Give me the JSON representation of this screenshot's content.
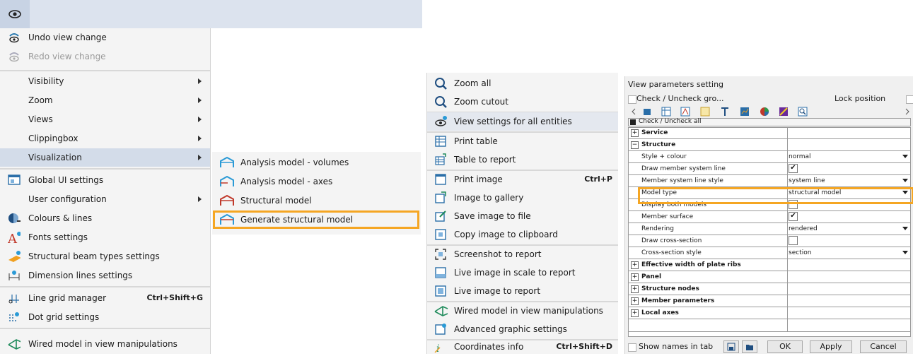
{
  "main_menu": {
    "items": [
      {
        "label": "Undo view change",
        "icon": "undo-view-icon"
      },
      {
        "label": "Redo view change",
        "icon": "redo-view-icon",
        "disabled": true
      },
      {
        "label": "Visibility",
        "submenu": true
      },
      {
        "label": "Zoom",
        "submenu": true
      },
      {
        "label": "Views",
        "submenu": true
      },
      {
        "label": "Clippingbox",
        "submenu": true
      },
      {
        "label": "Visualization",
        "submenu": true,
        "highlighted": true
      },
      {
        "label": "Global UI settings",
        "icon": "global-ui-settings-icon"
      },
      {
        "label": "User configuration",
        "submenu": true
      },
      {
        "label": "Colours & lines",
        "icon": "colours-lines-icon"
      },
      {
        "label": "Fonts settings",
        "icon": "fonts-settings-icon"
      },
      {
        "label": "Structural beam types settings",
        "icon": "beam-types-icon"
      },
      {
        "label": "Dimension lines settings",
        "icon": "dimension-lines-icon"
      },
      {
        "label": "Line grid manager",
        "shortcut": "Ctrl+Shift+G",
        "icon": "line-grid-icon"
      },
      {
        "label": "Dot grid settings",
        "icon": "dot-grid-icon"
      },
      {
        "label": "Wired model in view manipulations",
        "icon": "wired-model-icon"
      }
    ]
  },
  "visualization_submenu": {
    "items": [
      {
        "label": "Analysis model - volumes"
      },
      {
        "label": "Analysis model - axes"
      },
      {
        "label": "Structural model"
      },
      {
        "label": "Generate structural model"
      }
    ]
  },
  "view_menu": {
    "items": [
      {
        "label": "Zoom all"
      },
      {
        "label": "Zoom cutout"
      },
      {
        "label": "View settings for all entities"
      },
      {
        "label": "Print table"
      },
      {
        "label": "Table to report"
      },
      {
        "label": "Print image",
        "shortcut": "Ctrl+P"
      },
      {
        "label": "Image to gallery"
      },
      {
        "label": "Save image to file"
      },
      {
        "label": "Copy image to clipboard"
      },
      {
        "label": "Screenshot to report"
      },
      {
        "label": "Live image in scale to report"
      },
      {
        "label": "Live image to report"
      },
      {
        "label": "Wired model in view manipulations"
      },
      {
        "label": "Advanced graphic settings"
      },
      {
        "label": "Coordinates info",
        "shortcut": "Ctrl+Shift+D"
      }
    ]
  },
  "panel": {
    "title": "View parameters setting",
    "check_group": "Check / Uncheck gro...",
    "lock_position": "Lock position",
    "check_all": "Check / Uncheck all",
    "rows": [
      {
        "name": "Service",
        "bold": true,
        "expander": "+"
      },
      {
        "name": "Structure",
        "bold": true,
        "expander": "−"
      },
      {
        "name": "Style + colour",
        "value": "normal",
        "dropdown": true
      },
      {
        "name": "Draw member system line",
        "checkbox": true,
        "checked": true
      },
      {
        "name": "Member system line style",
        "value": "system line",
        "dropdown": true
      },
      {
        "name": "Model type",
        "value": "structural model",
        "dropdown": true
      },
      {
        "name": "Display both models",
        "checkbox": true,
        "checked": false
      },
      {
        "name": "Member surface",
        "checkbox": true,
        "checked": true
      },
      {
        "name": "Rendering",
        "value": "rendered",
        "dropdown": true
      },
      {
        "name": "Draw cross-section",
        "checkbox": true,
        "checked": false
      },
      {
        "name": "Cross-section style",
        "value": "section",
        "dropdown": true
      },
      {
        "name": "Effective width of plate ribs",
        "bold": true,
        "expander": "+"
      },
      {
        "name": "Panel",
        "bold": true,
        "expander": "+"
      },
      {
        "name": "Structure nodes",
        "bold": true,
        "expander": "+"
      },
      {
        "name": "Member parameters",
        "bold": true,
        "expander": "+"
      },
      {
        "name": "Local axes",
        "bold": true,
        "expander": "+"
      }
    ],
    "footer": {
      "show_names": "Show names in tab",
      "ok": "OK",
      "apply": "Apply",
      "cancel": "Cancel"
    }
  },
  "colors": {
    "highlight_border": "#f5a623",
    "menu_bg": "#f4f4f4",
    "selected_bg": "#d3dce9"
  }
}
